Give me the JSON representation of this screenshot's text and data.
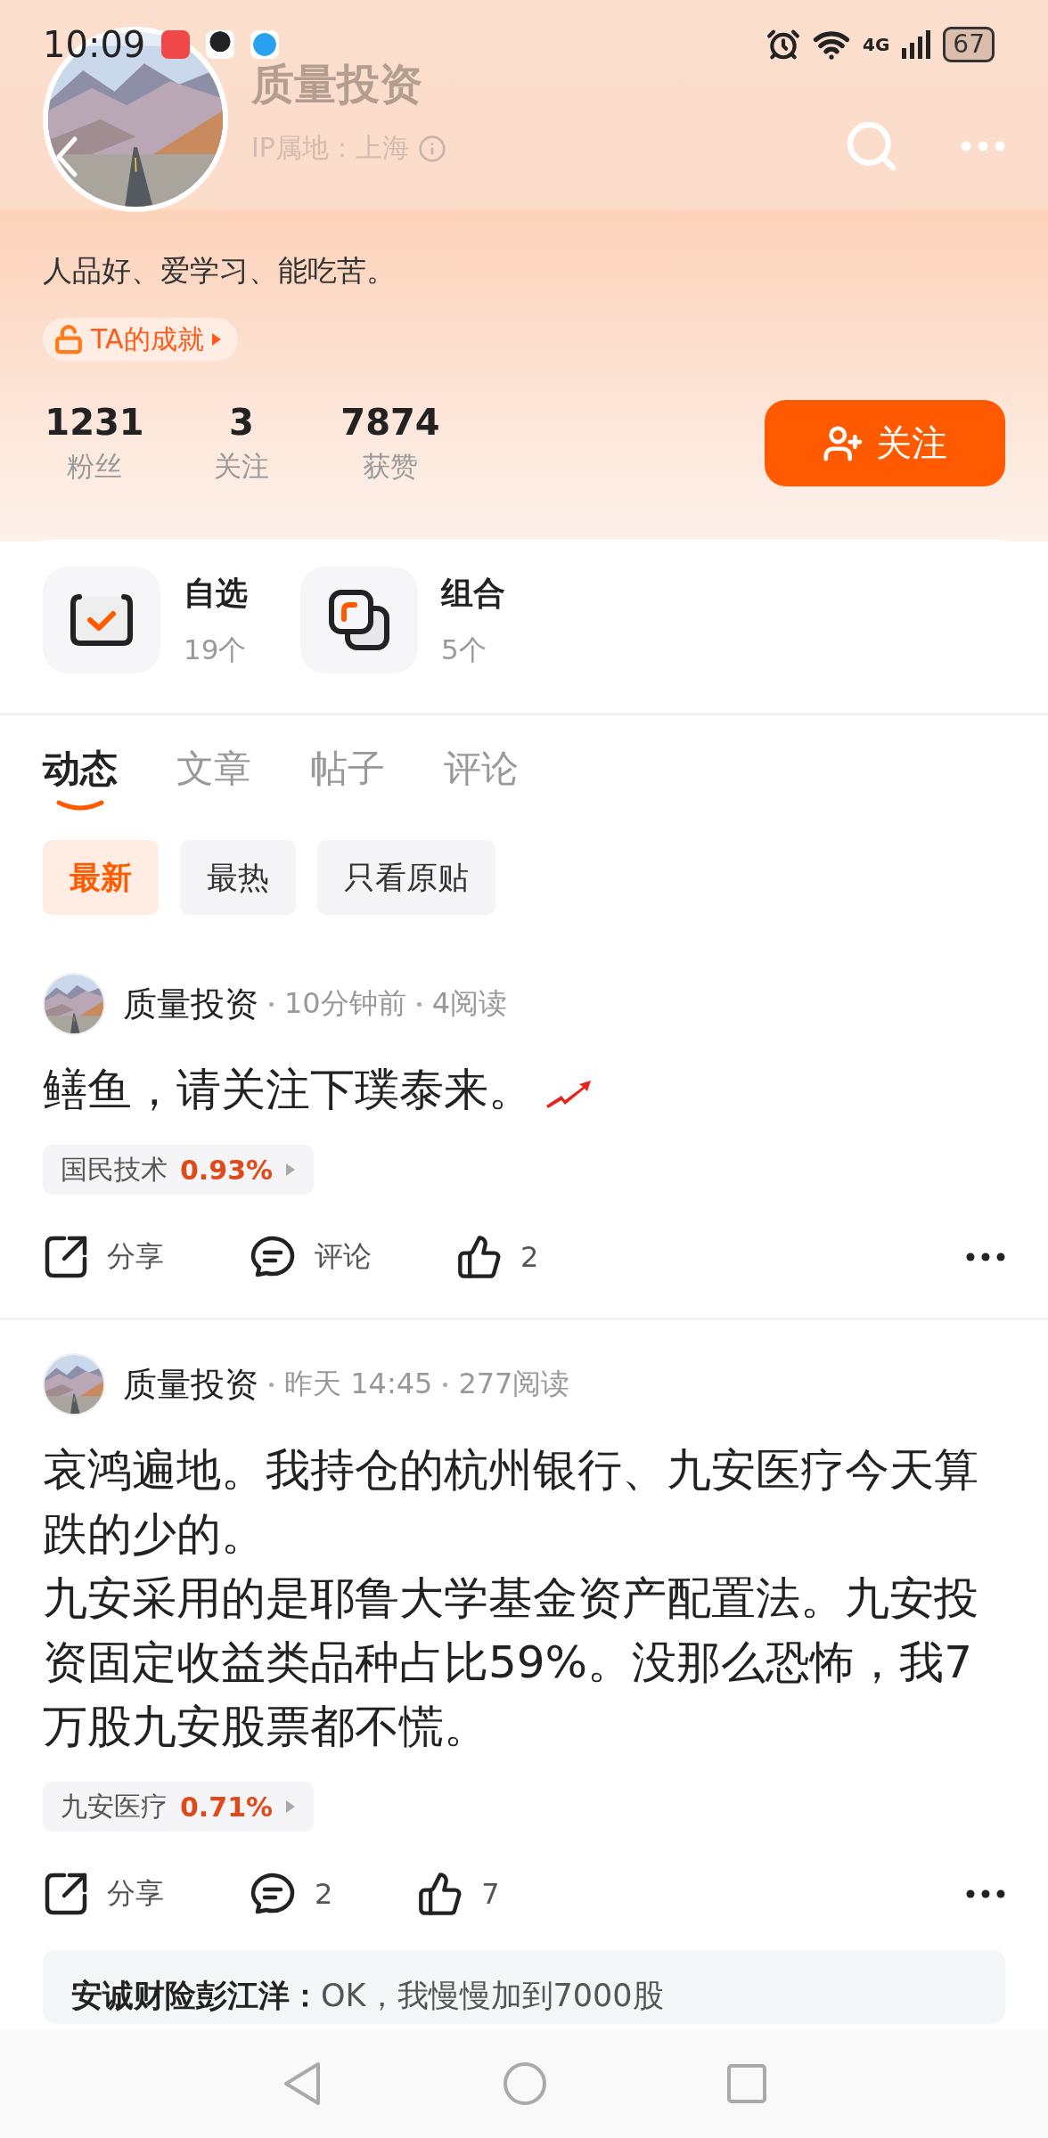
{
  "status_bar": {
    "time": "10:09",
    "network": "4G",
    "battery": "67"
  },
  "profile": {
    "name": "质量投资",
    "ip_location": "IP属地：上海",
    "bio": "人品好、爱学习、能吃苦。",
    "achievement": "TA的成就",
    "follow_button": "关注"
  },
  "stats": [
    {
      "value": "1231",
      "label": "粉丝"
    },
    {
      "value": "3",
      "label": "关注"
    },
    {
      "value": "7874",
      "label": "获赞"
    }
  ],
  "shortcuts": [
    {
      "kind": "watchlist",
      "title": "自选",
      "count": "19个"
    },
    {
      "kind": "portfolio",
      "title": "组合",
      "count": "5个"
    }
  ],
  "tabs": [
    {
      "label": "动态",
      "selected": true
    },
    {
      "label": "文章",
      "selected": false
    },
    {
      "label": "帖子",
      "selected": false
    },
    {
      "label": "评论",
      "selected": false
    }
  ],
  "filters": [
    {
      "label": "最新",
      "selected": true
    },
    {
      "label": "最热",
      "selected": false
    },
    {
      "label": "只看原贴",
      "selected": false
    }
  ],
  "posts": [
    {
      "author": "质量投资",
      "time": "10分钟前",
      "reads": "4阅读",
      "paragraphs": [
        "鳝鱼，请关注下璞泰来。"
      ],
      "trend_icon": true,
      "stock": {
        "name": "国民技术",
        "change": "0.93%"
      },
      "share": "分享",
      "comment": "评论",
      "likes": "2"
    },
    {
      "author": "质量投资",
      "time": "昨天 14:45",
      "reads": "277阅读",
      "paragraphs": [
        "哀鸿遍地。我持仓的杭州银行、九安医疗今天算跌的少的。",
        "九安采用的是耶鲁大学基金资产配置法。九安投资固定收益类品种占比59%。没那么恐怖，我7万股九安股票都不慌。"
      ],
      "stock": {
        "name": "九安医疗",
        "change": "0.71%"
      },
      "share": "分享",
      "comment": "2",
      "likes": "7",
      "reply": "**安诚财险彭江洋：**OK，我慢慢加到7000股"
    }
  ]
}
